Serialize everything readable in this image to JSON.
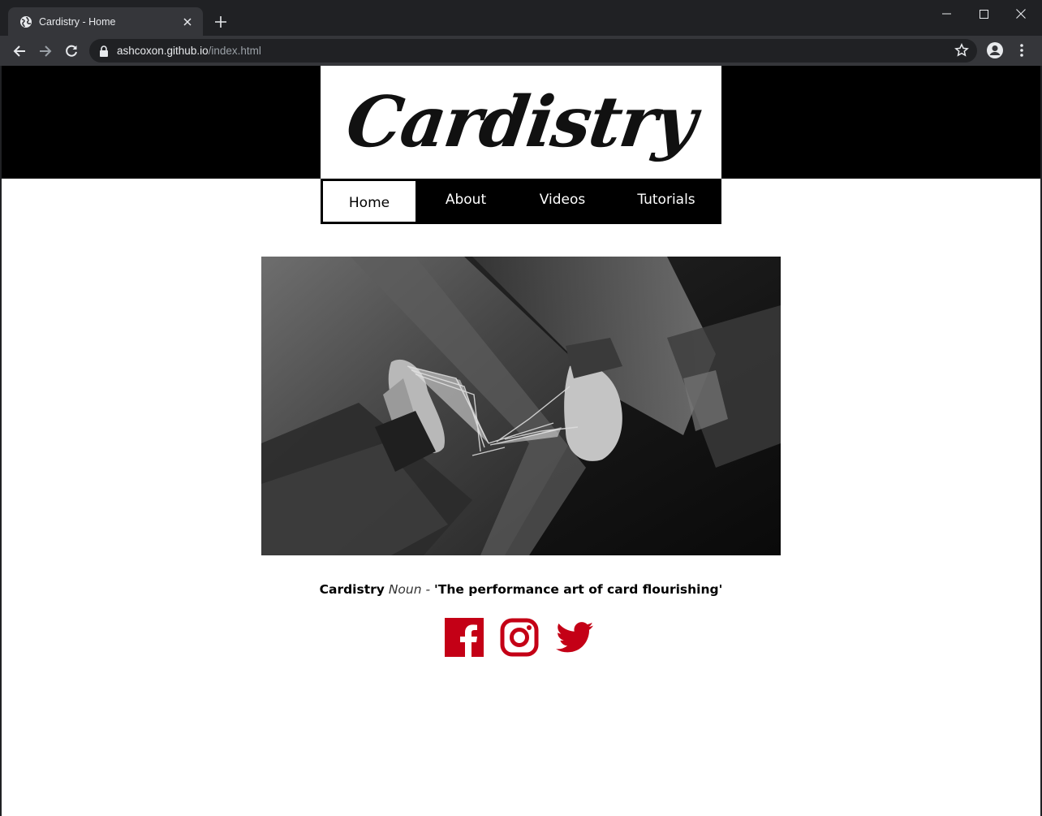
{
  "browser": {
    "tab_title": "Cardistry - Home",
    "url_host": "ashcoxon.github.io",
    "url_path": "/index.html",
    "icons": [
      "globe-icon",
      "close-icon",
      "plus-icon",
      "minimize-icon",
      "maximize-icon",
      "window-close-icon",
      "back-icon",
      "forward-icon",
      "reload-icon",
      "lock-icon",
      "star-icon",
      "profile-icon",
      "menu-icon"
    ]
  },
  "header": {
    "logo_text": "Cardistry"
  },
  "nav": {
    "items": [
      {
        "label": "Home",
        "active": true
      },
      {
        "label": "About",
        "active": false
      },
      {
        "label": "Videos",
        "active": false
      },
      {
        "label": "Tutorials",
        "active": false
      }
    ]
  },
  "hero": {
    "icon": "card-flourish-photo"
  },
  "tagline": {
    "term": "Cardistry",
    "part_of_speech": "Noun",
    "separator": " - ",
    "definition": "'The performance art of card flourishing'"
  },
  "social": {
    "accent_color": "#c40016",
    "links": [
      "facebook-icon",
      "instagram-icon",
      "twitter-icon"
    ]
  }
}
